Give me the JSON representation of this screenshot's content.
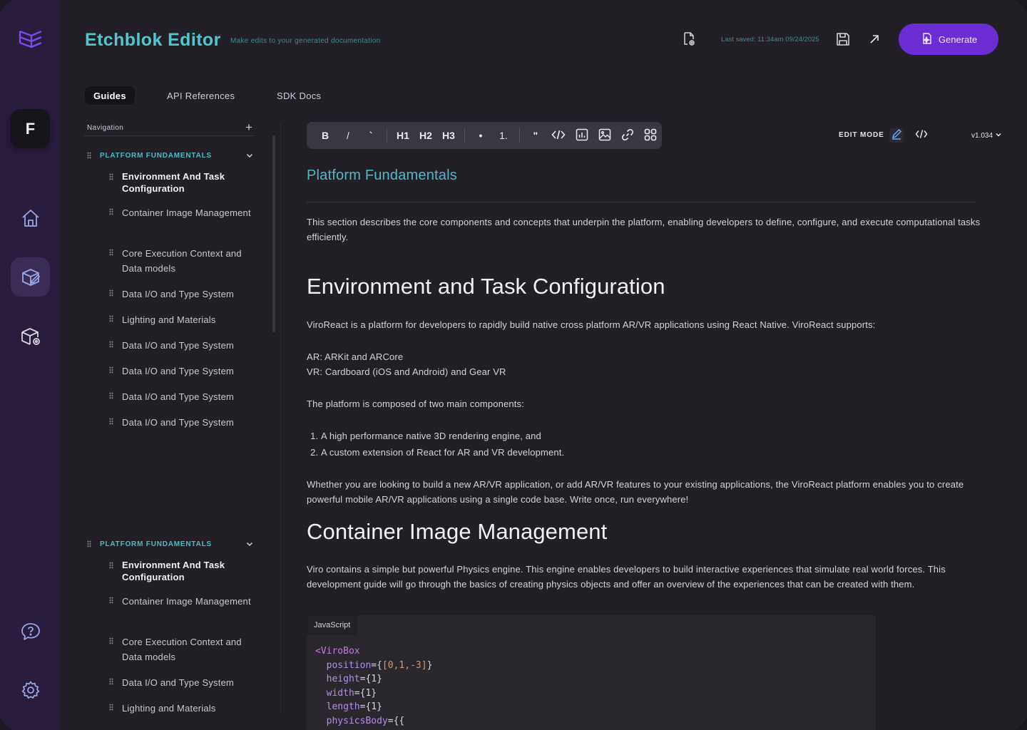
{
  "app": {
    "title": "Etchblok Editor",
    "subtitle": "Make edits to your generated documentation",
    "last_saved": "Last saved: 11:34am 09/24/2025",
    "generate_label": "Generate",
    "avatar_initial": "F",
    "accent": "#52c6cf",
    "brand_purple": "#6a2ed4"
  },
  "tabs": [
    {
      "label": "Guides",
      "active": true
    },
    {
      "label": "API References",
      "active": false
    },
    {
      "label": "SDK Docs",
      "active": false
    }
  ],
  "sidebar": {
    "label": "Navigation",
    "groups": [
      {
        "title": "PLATFORM FUNDAMENTALS",
        "items": [
          "Environment And Task Configuration",
          "Container Image Management",
          "Core Execution Context and Data models",
          "Data I/O and Type System",
          "Lighting and Materials",
          "Data I/O and Type System",
          "Data I/O and Type System",
          "Data I/O and Type System",
          "Data I/O and Type System"
        ]
      },
      {
        "title": "PLATFORM FUNDAMENTALS",
        "items": [
          "Environment And Task Configuration",
          "Container Image Management",
          "Core Execution Context and Data models",
          "Data I/O and Type System",
          "Lighting and Materials"
        ]
      }
    ]
  },
  "toolbar": {
    "bold": "B",
    "italic": "/",
    "code_inline": "`",
    "h1": "H1",
    "h2": "H2",
    "h3": "H3",
    "bullet": "•",
    "numbered": "1.",
    "quote": "\"",
    "edit_mode_label": "EDIT MODE",
    "version": "v1.034"
  },
  "content": {
    "title": "Platform Fundamentals",
    "intro": "This section describes the core components and concepts that underpin the platform, enabling developers to define, configure, and execute computational tasks efficiently.",
    "section1": {
      "heading": "Environment and Task Configuration",
      "p1": "ViroReact is a platform for developers to rapidly build native cross platform AR/VR applications using React Native. ViroReact supports:",
      "ar": "AR: ARKit and ARCore",
      "vr": "VR: Cardboard (iOS and Android) and Gear VR",
      "p2": "The platform is composed of two main components:",
      "list": [
        "A high performance native 3D rendering engine, and",
        "A custom extension of React for AR and VR development."
      ],
      "p3": "Whether you are looking to build a new AR/VR application, or add AR/VR features to your existing applications, the ViroReact platform enables you to create powerful mobile AR/VR applications using a single code base. Write once, run everywhere!"
    },
    "section2": {
      "heading": "Container Image Management",
      "p1": "Viro contains a simple but powerful Physics engine. This engine enables developers to build interactive experiences that simulate real world forces. This development guide will go through the basics of creating physics objects and offer an overview of the experiences that can be created with them."
    },
    "code": {
      "language": "JavaScript",
      "tag": "<ViroBox",
      "attrs": [
        {
          "name": "position",
          "value": "[0,1,-3]"
        },
        {
          "name": "height",
          "value": "1"
        },
        {
          "name": "width",
          "value": "1"
        },
        {
          "name": "length",
          "value": "1"
        },
        {
          "name": "physicsBody",
          "value": "{"
        }
      ]
    }
  }
}
